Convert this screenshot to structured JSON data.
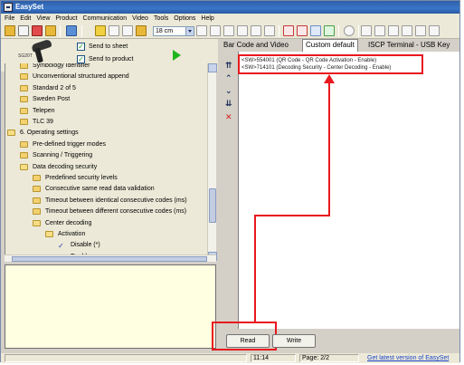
{
  "window": {
    "title": "EasySet"
  },
  "menu": [
    "File",
    "Edit",
    "View",
    "Product",
    "Communication",
    "Video",
    "Tools",
    "Options",
    "Help"
  ],
  "toolbar": {
    "zoom_value": "18 cm"
  },
  "device": {
    "model": "SG20T",
    "send_to_sheet": "Send to sheet",
    "send_to_product": "Send to product"
  },
  "tree": [
    {
      "label": "Symbology Identifier",
      "indent": 2,
      "icon": "folder"
    },
    {
      "label": "Unconventional structured append",
      "indent": 2,
      "icon": "folder"
    },
    {
      "label": "Standard 2 of 5",
      "indent": 2,
      "icon": "folder"
    },
    {
      "label": "Sweden Post",
      "indent": 2,
      "icon": "folder"
    },
    {
      "label": "Telepen",
      "indent": 2,
      "icon": "folder"
    },
    {
      "label": "TLC 39",
      "indent": 2,
      "icon": "folder"
    },
    {
      "label": "6. Operating settings",
      "indent": 1,
      "icon": "folder-open"
    },
    {
      "label": "Pre-defined trigger modes",
      "indent": 2,
      "icon": "folder"
    },
    {
      "label": "Scanning / Triggering",
      "indent": 2,
      "icon": "folder"
    },
    {
      "label": "Data decoding security",
      "indent": 2,
      "icon": "folder-open"
    },
    {
      "label": "Predefined security levels",
      "indent": 3,
      "icon": "folder"
    },
    {
      "label": "Consecutive same read data validation",
      "indent": 3,
      "icon": "folder"
    },
    {
      "label": "Timeout between identical consecutive codes (ms)",
      "indent": 3,
      "icon": "folder"
    },
    {
      "label": "Timeout between different consecutive codes (ms)",
      "indent": 3,
      "icon": "folder"
    },
    {
      "label": "Center decoding",
      "indent": 3,
      "icon": "folder-open"
    },
    {
      "label": "Activation",
      "indent": 4,
      "icon": "folder-open"
    },
    {
      "label": "Disable (*)",
      "indent": 5,
      "icon": "check"
    },
    {
      "label": "Enable",
      "indent": 5,
      "icon": "square"
    }
  ],
  "tabs": [
    "Bar Code and Video",
    "Custom default",
    "ISCP Terminal - USB Key"
  ],
  "active_tab": "Custom default",
  "code_lines": [
    "<SW>554001 (QR Code - QR Code Activation - Enable)",
    "<SW>714101 (Decoding Security - Center Decoding - Enable)"
  ],
  "buttons": {
    "read": "Read",
    "write": "Write"
  },
  "status": {
    "time": "11:14",
    "page": "Page: 2/2",
    "link": "Get latest version of EasySet"
  },
  "colors": {
    "highlight": "#e8181e",
    "title_bar": "#2f5fa8",
    "link": "#1b46c9"
  }
}
